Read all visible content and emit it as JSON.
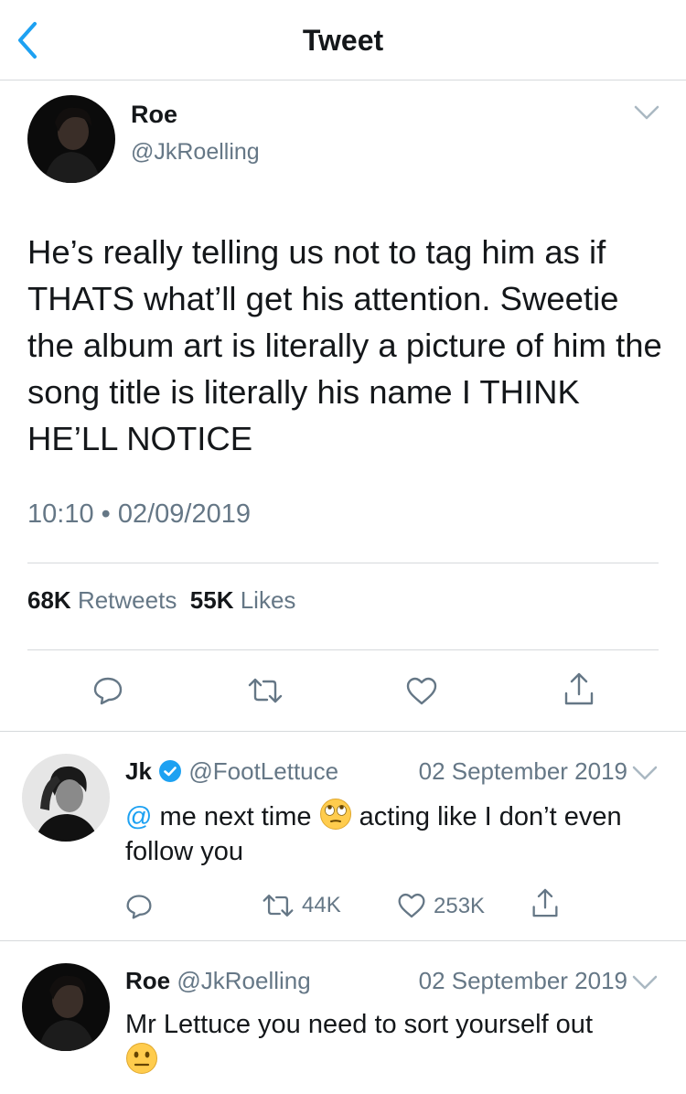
{
  "nav": {
    "title": "Tweet"
  },
  "tweet": {
    "name": "Roe",
    "handle": "@JkRoelling",
    "text": "He’s really telling us not to tag him as if THATS what’ll get his attention. Sweetie the album art is literally a picture of him the song title is literally his name I THINK HE’LL NOTICE",
    "time": "10:10",
    "separator": "•",
    "date": "02/09/2019",
    "retweets_count": "68K",
    "retweets_label": "Retweets",
    "likes_count": "55K",
    "likes_label": "Likes"
  },
  "replies": [
    {
      "name": "Jk",
      "verified": true,
      "handle": "@FootLettuce",
      "date": "02 September 2019",
      "mention": "@",
      "text_before_emoji": " me next time ",
      "emoji": "eye-roll",
      "text_after_emoji": " acting like I don’t even follow you",
      "retweets": "44K",
      "likes": "253K"
    },
    {
      "name": "Roe",
      "handle": "@JkRoelling",
      "date": "02 September 2019",
      "text": "Mr Lettuce you need to sort yourself out",
      "emoji": "neutral-face"
    }
  ],
  "colors": {
    "accent": "#1da1f2",
    "secondary_text": "#657786",
    "primary_text": "#14171a",
    "divider": "#d6d9dc"
  },
  "icons": [
    "back-chevron-icon",
    "chevron-down-icon",
    "reply-icon",
    "retweet-icon",
    "like-icon",
    "share-icon",
    "verified-badge-icon"
  ]
}
